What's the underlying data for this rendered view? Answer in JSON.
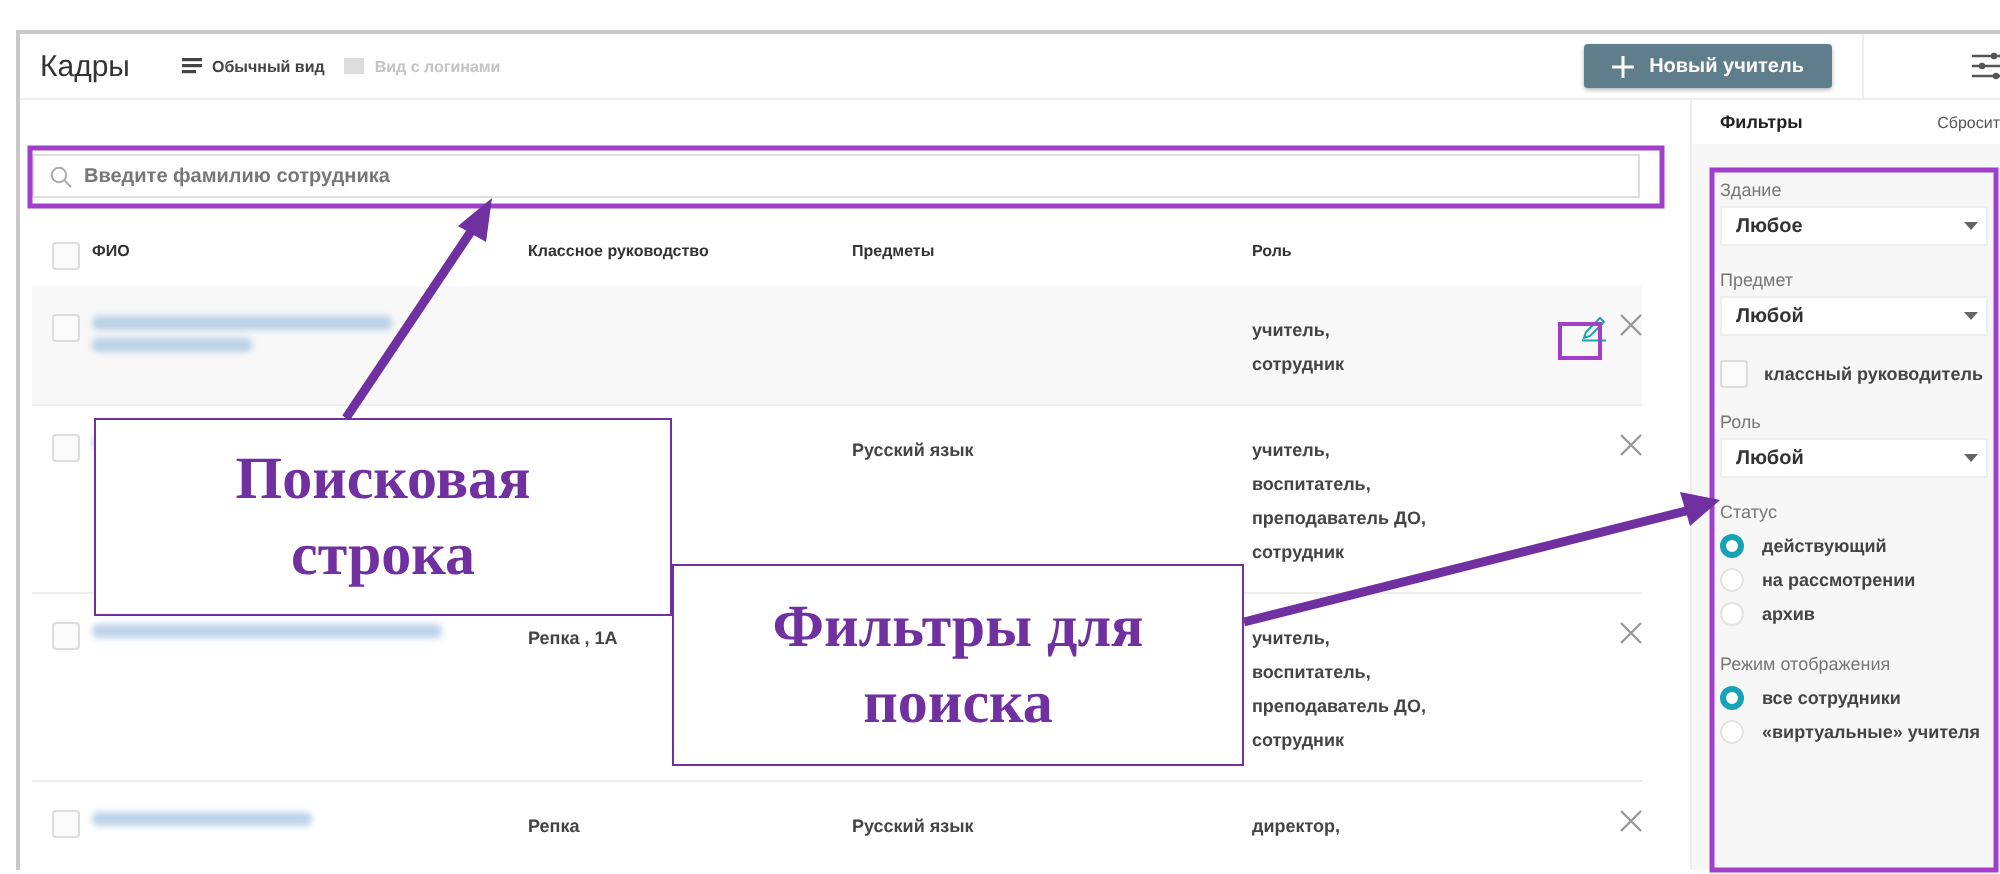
{
  "page": {
    "title": "Кадры"
  },
  "views": [
    {
      "label": "Обычный вид",
      "selected": true
    },
    {
      "label": "Вид с логинами",
      "selected": false
    }
  ],
  "new_button": {
    "label": "Новый учитель"
  },
  "search": {
    "placeholder": "Введите фамилию сотрудника"
  },
  "table": {
    "select_all_checked": false,
    "columns": [
      "ФИО",
      "Классное руководство",
      "Предметы",
      "Роль"
    ],
    "rows": [
      {
        "hovered": true,
        "checked": false,
        "class_teacher": "",
        "subjects": [],
        "roles": [
          "учитель,",
          "сотрудник"
        ]
      },
      {
        "hovered": false,
        "checked": false,
        "class_teacher": "",
        "subjects": [
          "Русский язык"
        ],
        "roles": [
          "учитель,",
          "воспитатель,",
          "преподаватель ДО,",
          "сотрудник"
        ]
      },
      {
        "hovered": false,
        "checked": false,
        "class_teacher": "Репка , 1А",
        "subjects": [],
        "roles": [
          "учитель,",
          "воспитатель,",
          "преподаватель ДО,",
          "сотрудник"
        ]
      },
      {
        "hovered": false,
        "checked": false,
        "class_teacher": "Репка",
        "subjects": [
          "Русский язык"
        ],
        "roles": [
          "директор,"
        ]
      }
    ]
  },
  "filters": {
    "title": "Фильтры",
    "reset": "Сбросит",
    "items": [
      {
        "kind": "select",
        "label": "Здание",
        "value": "Любое"
      },
      {
        "kind": "select",
        "label": "Предмет",
        "value": "Любой"
      },
      {
        "kind": "checkbox",
        "label": "классный руководитель",
        "checked": false
      },
      {
        "kind": "select",
        "label": "Роль",
        "value": "Любой"
      },
      {
        "kind": "radio",
        "label": "Статус",
        "options": [
          {
            "label": "действующий",
            "selected": true
          },
          {
            "label": "на рассмотрении",
            "selected": false
          },
          {
            "label": "архив",
            "selected": false
          }
        ]
      },
      {
        "kind": "radio",
        "label": "Режим отображения",
        "options": [
          {
            "label": "все сотрудники",
            "selected": true
          },
          {
            "label": "«виртуальные» учителя",
            "selected": false
          }
        ]
      }
    ]
  },
  "annotations": [
    {
      "text": "Поисковая строка"
    },
    {
      "text": "Фильтры для поиска"
    }
  ]
}
